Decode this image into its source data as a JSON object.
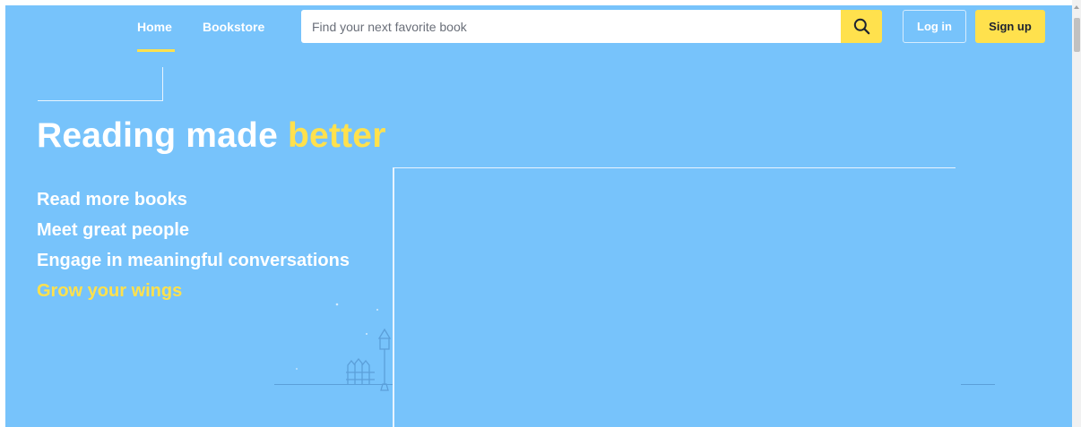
{
  "nav": {
    "home": "Home",
    "bookstore": "Bookstore"
  },
  "search": {
    "placeholder": "Find your next favorite book",
    "icon": "search-icon"
  },
  "auth": {
    "login": "Log in",
    "signup": "Sign up"
  },
  "hero": {
    "headline_main": "Reading made",
    "headline_accent": "better",
    "taglines": [
      "Read more books",
      "Meet great people",
      "Engage in meaningful conversations",
      "Grow your wings"
    ]
  },
  "colors": {
    "background": "#77c3fb",
    "accent": "#ffe14d",
    "text": "#ffffff"
  }
}
